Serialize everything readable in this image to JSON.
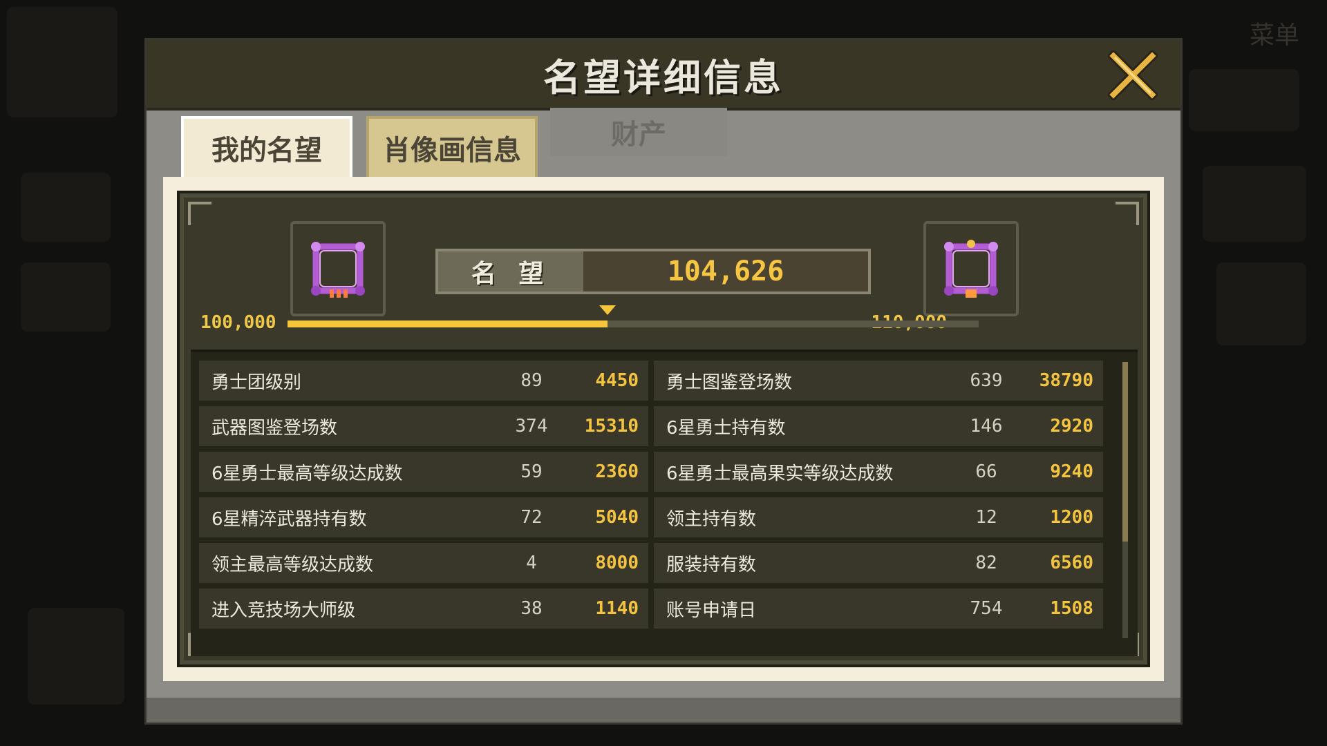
{
  "background": {
    "menu_label": "菜单"
  },
  "dialog": {
    "title": "名望详细信息",
    "close_icon": "close-x-icon"
  },
  "tabs": [
    {
      "label": "我的名望",
      "state": "active"
    },
    {
      "label": "肖像画信息",
      "state": "normal"
    },
    {
      "label": "财产",
      "state": "disabled"
    }
  ],
  "reputation": {
    "label": "名 望",
    "value": "104,626",
    "range_min": "100,000",
    "range_max": "110,000",
    "progress_fraction": 0.4626,
    "left_frame_icon": "purple-portrait-frame-icon",
    "right_frame_icon": "purple-portrait-frame-icon"
  },
  "stats": [
    {
      "label": "勇士团级别",
      "count": "89",
      "points": "4450"
    },
    {
      "label": "勇士图鉴登场数",
      "count": "639",
      "points": "38790"
    },
    {
      "label": "武器图鉴登场数",
      "count": "374",
      "points": "15310"
    },
    {
      "label": "6星勇士持有数",
      "count": "146",
      "points": "2920"
    },
    {
      "label": "6星勇士最高等级达成数",
      "count": "59",
      "points": "2360"
    },
    {
      "label": "6星勇士最高果实等级达成数",
      "count": "66",
      "points": "9240"
    },
    {
      "label": "6星精淬武器持有数",
      "count": "72",
      "points": "5040"
    },
    {
      "label": "领主持有数",
      "count": "12",
      "points": "1200"
    },
    {
      "label": "领主最高等级达成数",
      "count": "4",
      "points": "8000"
    },
    {
      "label": "服装持有数",
      "count": "82",
      "points": "6560"
    },
    {
      "label": "进入竞技场大师级",
      "count": "38",
      "points": "1140"
    },
    {
      "label": "账号申请日",
      "count": "754",
      "points": "1508"
    }
  ],
  "colors": {
    "accent_gold": "#f5c63a",
    "panel_dark": "#3b3a2a",
    "frame_purple": "#b35cd6"
  }
}
